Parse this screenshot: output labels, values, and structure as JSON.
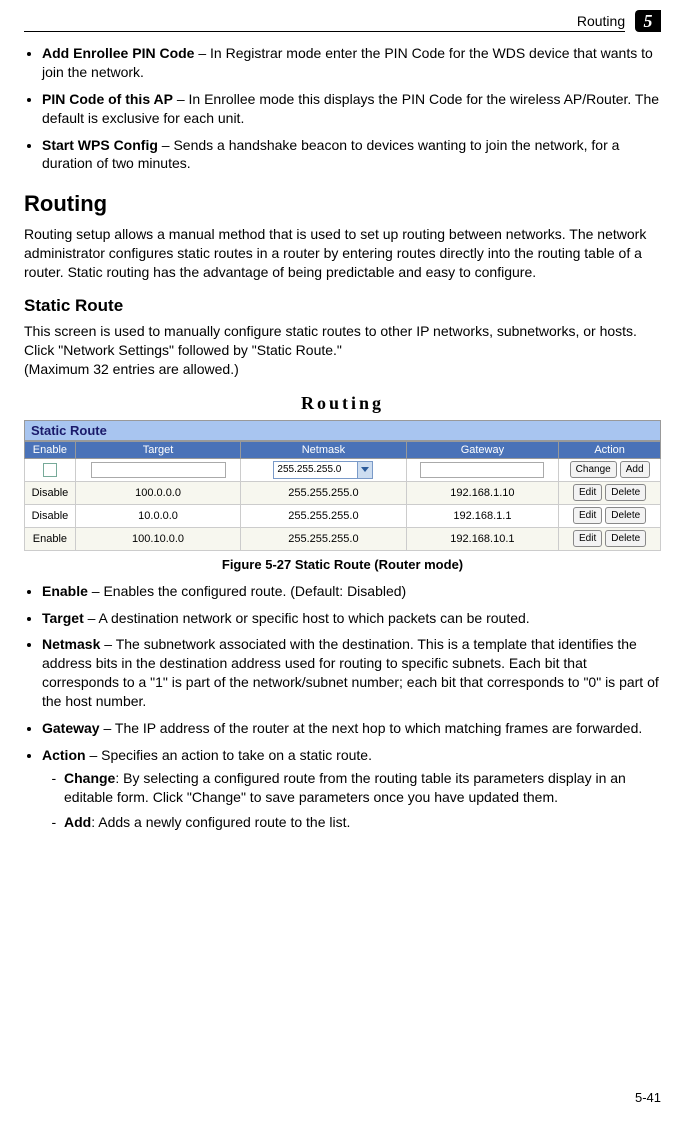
{
  "header": {
    "section": "Routing",
    "chapter": "5"
  },
  "intro_bullets": [
    {
      "term": "Add Enrollee PIN Code",
      "text": " – In Registrar mode enter the PIN Code for the WDS device that wants to join the network."
    },
    {
      "term": "PIN Code of this AP",
      "text": " – In Enrollee mode this displays the PIN Code for the wireless AP/Router. The default is exclusive for each unit."
    },
    {
      "term": "Start WPS Config",
      "text": " – Sends a handshake beacon to devices wanting to join the network, for a duration of two minutes."
    }
  ],
  "h1": "Routing",
  "p1": "Routing setup allows a manual method that is used to set up routing between networks. The network administrator configures static routes in a router by entering routes directly into the routing table of a router. Static routing has the advantage of being predictable and easy to configure.",
  "h2": "Static Route",
  "p2a": "This screen is used to manually configure static routes to other IP networks, subnetworks, or hosts. Click \"Network Settings\" followed by \"Static Route.\"",
  "p2b": "(Maximum 32 entries are allowed.)",
  "figure": {
    "title": "Routing",
    "panel_label": "Static Route",
    "headers": {
      "c1": "Enable",
      "c2": "Target",
      "c3": "Netmask",
      "c4": "Gateway",
      "c5": "Action"
    },
    "input_row": {
      "netmask_sel": "255.255.255.0",
      "btn_change": "Change",
      "btn_add": "Add"
    },
    "rows": [
      {
        "enable": "Disable",
        "target": "100.0.0.0",
        "netmask": "255.255.255.0",
        "gateway": "192.168.1.10",
        "btn_edit": "Edit",
        "btn_del": "Delete"
      },
      {
        "enable": "Disable",
        "target": "10.0.0.0",
        "netmask": "255.255.255.0",
        "gateway": "192.168.1.1",
        "btn_edit": "Edit",
        "btn_del": "Delete"
      },
      {
        "enable": "Enable",
        "target": "100.10.0.0",
        "netmask": "255.255.255.0",
        "gateway": "192.168.10.1",
        "btn_edit": "Edit",
        "btn_del": "Delete"
      }
    ],
    "caption": "Figure 5-27  Static Route (Router mode)"
  },
  "defs": [
    {
      "term": "Enable",
      "text": " – Enables the configured route. (Default: Disabled)"
    },
    {
      "term": "Target",
      "text": " – A destination network or specific host to which packets can be routed."
    },
    {
      "term": "Netmask",
      "text": " – The subnetwork associated with the destination. This is a template that identifies the address bits in the destination address used for routing to specific subnets. Each bit that corresponds to a \"1\" is part of the network/subnet number; each bit that corresponds to \"0\" is part of the host number."
    },
    {
      "term": "Gateway",
      "text": " – The IP address of the router at the next hop to which matching frames are forwarded."
    },
    {
      "term": "Action",
      "text": " – Specifies an action to take on a static route."
    }
  ],
  "sub": [
    {
      "term": "Change",
      "text": ": By selecting a configured route from the routing table its parameters display in an editable form. Click \"Change\" to save parameters once you have updated them."
    },
    {
      "term": "Add",
      "text": ": Adds a newly configured route to the list."
    }
  ],
  "page_number": "5-41"
}
